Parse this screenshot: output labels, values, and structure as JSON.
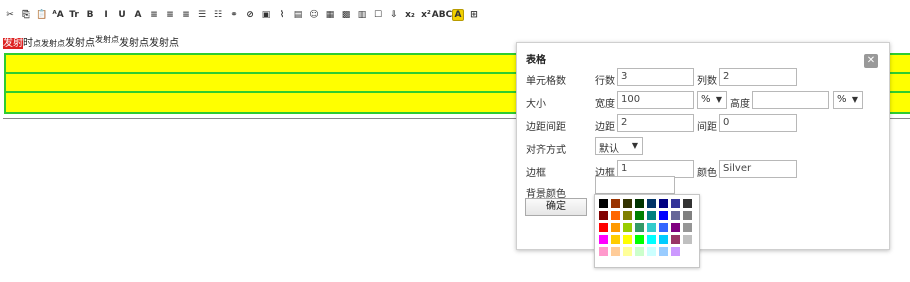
{
  "toolbar": {
    "items": [
      {
        "name": "cut-icon",
        "glyph": "✂"
      },
      {
        "name": "copy-icon",
        "glyph": "⎘"
      },
      {
        "name": "paste-icon",
        "glyph": "📋"
      },
      {
        "name": "font-size-icon",
        "glyph": "ᴬA"
      },
      {
        "name": "font-family-icon",
        "glyph": "Tr"
      },
      {
        "name": "bold-icon",
        "glyph": "B"
      },
      {
        "name": "italic-icon",
        "glyph": "I"
      },
      {
        "name": "underline-icon",
        "glyph": "U"
      },
      {
        "name": "font-color-icon",
        "glyph": "A"
      },
      {
        "name": "align-left-icon",
        "glyph": "≡"
      },
      {
        "name": "align-center-icon",
        "glyph": "≡"
      },
      {
        "name": "align-right-icon",
        "glyph": "≡"
      },
      {
        "name": "ordered-list-icon",
        "glyph": "☰"
      },
      {
        "name": "unordered-list-icon",
        "glyph": "☷"
      },
      {
        "name": "link-icon",
        "glyph": "⚭"
      },
      {
        "name": "unlink-icon",
        "glyph": "⊘"
      },
      {
        "name": "image-icon",
        "glyph": "▣"
      },
      {
        "name": "attachment-icon",
        "glyph": "⌇"
      },
      {
        "name": "media-icon",
        "glyph": "▤"
      },
      {
        "name": "emoticon-icon",
        "glyph": "☺"
      },
      {
        "name": "table-icon",
        "glyph": "▦"
      },
      {
        "name": "map-icon",
        "glyph": "▩"
      },
      {
        "name": "code-icon",
        "glyph": "▥"
      },
      {
        "name": "checkbox-icon",
        "glyph": "☐"
      },
      {
        "name": "insert-hr-icon",
        "glyph": "⇩"
      },
      {
        "name": "subscript-icon",
        "glyph": "x₂"
      },
      {
        "name": "superscript-icon",
        "glyph": "x²"
      },
      {
        "name": "spellcheck-icon",
        "glyph": "ABC"
      },
      {
        "name": "highlight-icon",
        "glyph": "A"
      },
      {
        "name": "source-icon",
        "glyph": "⊞"
      }
    ]
  },
  "editor": {
    "line_selected": "发射",
    "line_a": "时",
    "line_b": "点发射点",
    "line_c": "发射点",
    "line_d": "发射点",
    "line_e": "发射点发射点"
  },
  "dialog": {
    "title": "表格",
    "close_glyph": "✕",
    "cells_label": "单元格数",
    "rows_label": "行数",
    "rows_value": "3",
    "cols_label": "列数",
    "cols_value": "2",
    "size_label": "大小",
    "width_label": "宽度",
    "width_value": "100",
    "width_unit": "%",
    "height_label": "高度",
    "height_value": "",
    "height_unit": "%",
    "spacing_label": "边距间距",
    "padding_label": "边距",
    "padding_value": "2",
    "gap_label": "间距",
    "gap_value": "0",
    "align_label": "对齐方式",
    "align_value": "默认",
    "border_section_label": "边框",
    "border_label": "边框",
    "border_value": "1",
    "color_label": "颜色",
    "color_value": "Silver",
    "bg_label": "背景颜色",
    "bg_value": "",
    "ok_label": "确定",
    "arrow_glyph": "▼"
  },
  "palette": {
    "rows": [
      [
        "#000000",
        "#993300",
        "#333300",
        "#003300",
        "#003366",
        "#000080",
        "#333399",
        "#333333"
      ],
      [
        "#800000",
        "#ff6600",
        "#808000",
        "#008000",
        "#008080",
        "#0000ff",
        "#666699",
        "#808080"
      ],
      [
        "#ff0000",
        "#ff9900",
        "#99cc00",
        "#339966",
        "#33cccc",
        "#3366ff",
        "#800080",
        "#969696"
      ],
      [
        "#ff00ff",
        "#ffcc00",
        "#ffff00",
        "#00ff00",
        "#00ffff",
        "#00ccff",
        "#993366",
        "#c0c0c0"
      ],
      [
        "#ff99cc",
        "#ffcc99",
        "#ffff99",
        "#ccffcc",
        "#ccffff",
        "#99ccff",
        "#cc99ff"
      ]
    ]
  },
  "colors": {
    "table_fill": "#ffff00",
    "table_border": "#2fcc2f",
    "selection": "#dd2222"
  }
}
